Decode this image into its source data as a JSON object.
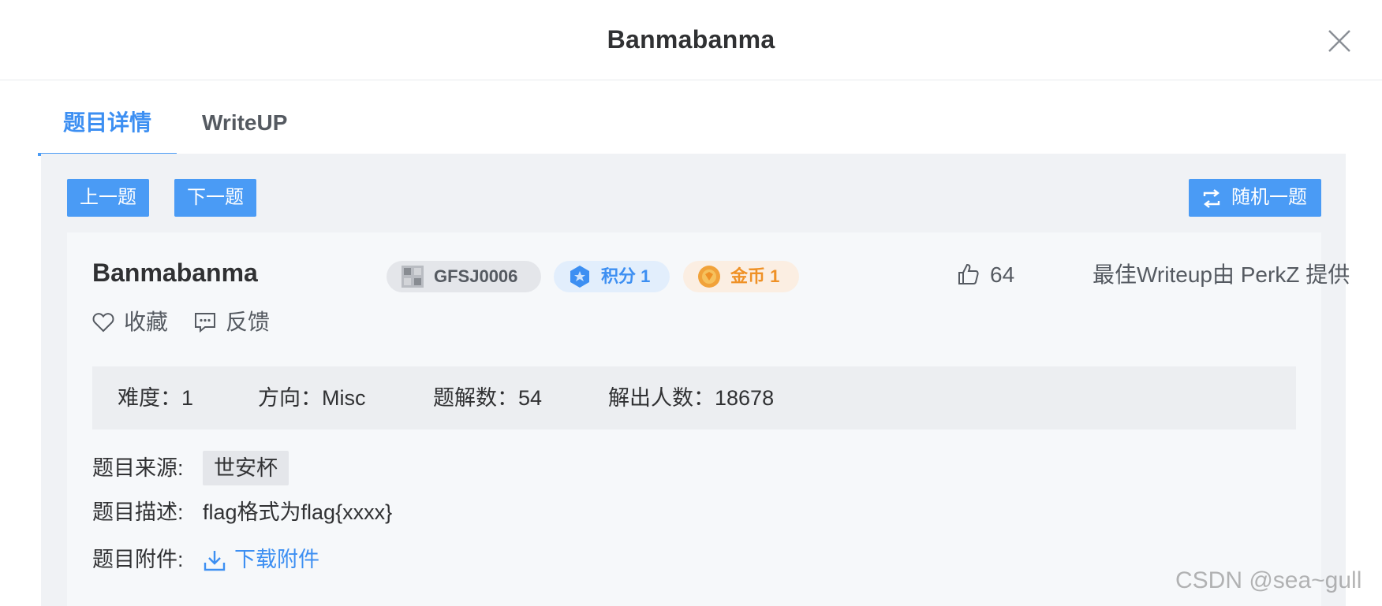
{
  "dialog": {
    "title": "Banmabanma",
    "close_icon": "close-icon"
  },
  "tabs": [
    {
      "label": "题目详情",
      "active": true
    },
    {
      "label": "WriteUP",
      "active": false
    }
  ],
  "toolbar": {
    "prev_label": "上一题",
    "next_label": "下一题",
    "random_label": "随机一题",
    "random_icon": "shuffle-icon"
  },
  "challenge": {
    "name": "Banmabanma",
    "id": "GFSJ0006",
    "score_label": "积分 1",
    "coin_label": "金币 1",
    "likes": "64",
    "best_writeup": "最佳Writeup由 PerkZ 提供",
    "favorite_label": "收藏",
    "feedback_label": "反馈",
    "stats": {
      "difficulty": "难度：1",
      "direction": "方向：Misc",
      "writeups": "题解数：54",
      "solvers": "解出人数：18678"
    },
    "source_key": "题目来源:",
    "source_value": "世安杯",
    "desc_key": "题目描述:",
    "desc_value": "flag格式为flag{xxxx}",
    "attach_key": "题目附件:",
    "attach_label": "下载附件"
  },
  "colors": {
    "accent": "#4a9bf5",
    "coin": "#ef9126",
    "panel_bg": "#f0f2f5"
  },
  "watermark": "CSDN @sea~gull"
}
